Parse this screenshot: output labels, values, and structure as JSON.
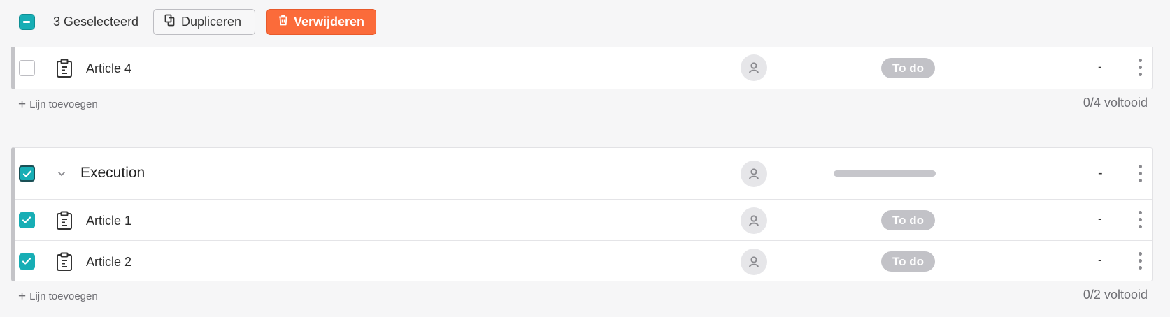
{
  "toolbar": {
    "selected_label": "3 Geselecteerd",
    "duplicate_label": "Dupliceren",
    "delete_label": "Verwijderen",
    "delete_color": "#fb6b3a",
    "accent_color": "#17aeb5"
  },
  "group1": {
    "items": [
      {
        "title": "Article 4",
        "status": "To do",
        "value": "-",
        "checked": false,
        "icon": "clipboard-icon"
      }
    ],
    "add_line_label": "Lijn toevoegen",
    "completed": "0/4 voltooid"
  },
  "group2": {
    "header": {
      "title": "Execution",
      "value": "-",
      "checked": true
    },
    "items": [
      {
        "title": "Article 1",
        "status": "To do",
        "value": "-",
        "checked": true,
        "icon": "clipboard-icon"
      },
      {
        "title": "Article 2",
        "status": "To do",
        "value": "-",
        "checked": true,
        "icon": "clipboard-icon"
      }
    ],
    "add_line_label": "Lijn toevoegen",
    "completed": "0/2 voltooid"
  }
}
